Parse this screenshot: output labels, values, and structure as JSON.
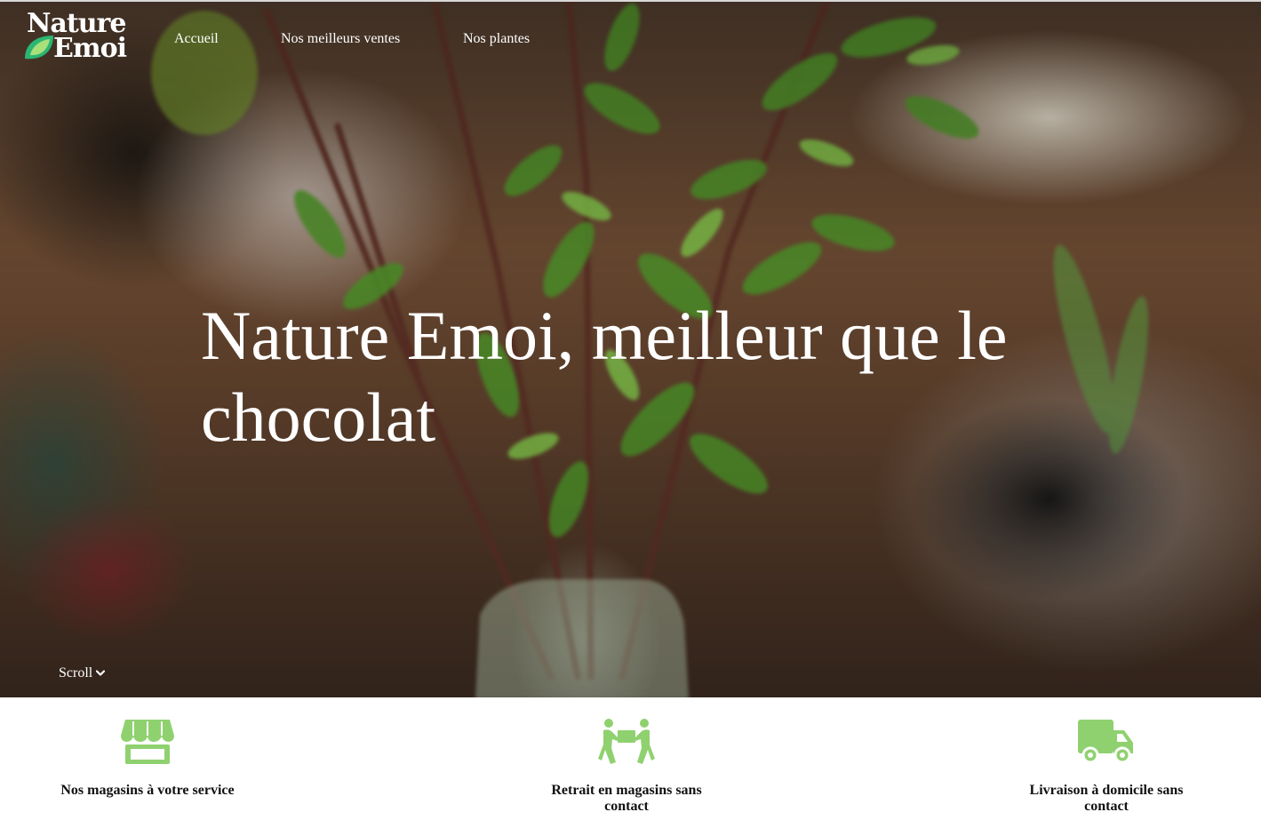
{
  "brand": {
    "line1": "Nature",
    "line2": "Emoi"
  },
  "nav": {
    "items": [
      {
        "label": "Accueil"
      },
      {
        "label": "Nos meilleurs ventes"
      },
      {
        "label": "Nos plantes"
      }
    ]
  },
  "hero": {
    "title": "Nature Emoi, meilleur que le chocolat",
    "scroll_label": "Scroll",
    "scroll_icon": "chevron-down-icon"
  },
  "features": [
    {
      "icon": "store-icon",
      "label": "Nos magasins à votre service"
    },
    {
      "icon": "people-carry-box-icon",
      "label": "Retrait en magasins sans contact"
    },
    {
      "icon": "truck-icon",
      "label": "Livraison à domicile sans contact"
    }
  ],
  "colors": {
    "accent": "#8fd16f",
    "logo_leaf_dark": "#2bb673",
    "logo_leaf_light": "#a8e07a",
    "text_dark": "#111111",
    "white": "#ffffff"
  }
}
